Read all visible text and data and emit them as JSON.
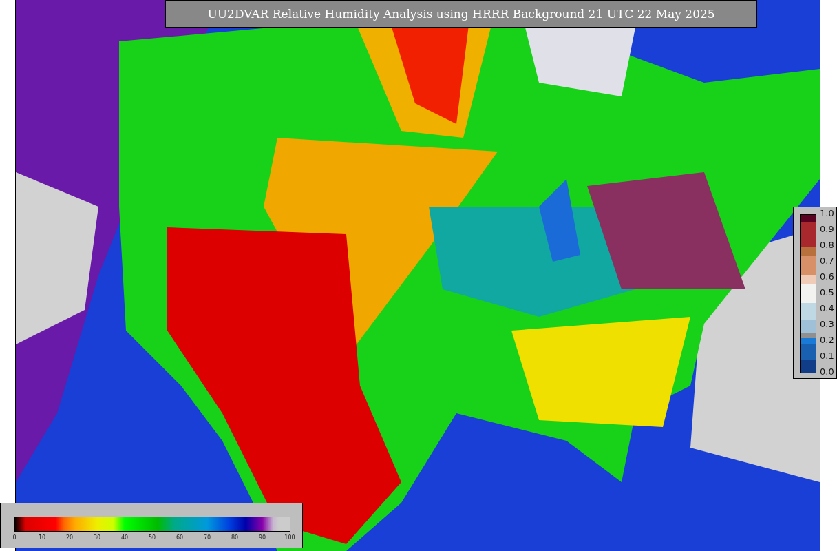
{
  "title": "UU2DVAR Relative Humidity Analysis using HRRR Background 21 UTC 22 May 2025",
  "humidity_legend": {
    "ticks": [
      "0",
      "10",
      "20",
      "30",
      "40",
      "50",
      "60",
      "70",
      "80",
      "90",
      "100"
    ]
  },
  "station_legend": {
    "ticks": [
      "1.0",
      "0.9",
      "0.8",
      "0.7",
      "0.6",
      "0.5",
      "0.4",
      "0.3",
      "0.2",
      "0.1",
      "0.0"
    ]
  }
}
